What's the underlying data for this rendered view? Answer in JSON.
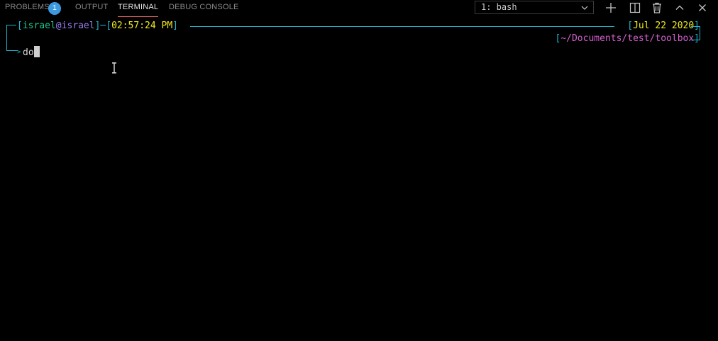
{
  "tabs": [
    {
      "label": "PROBLEMS",
      "active": false
    },
    {
      "label": "OUTPUT",
      "active": false
    },
    {
      "label": "TERMINAL",
      "active": true
    },
    {
      "label": "DEBUG CONSOLE",
      "active": false
    }
  ],
  "problems_count": "1",
  "terminal_select": {
    "value": "1: bash"
  },
  "toolbar_icons": [
    "plus-icon",
    "split-icon",
    "trash-icon",
    "chevron-up-icon",
    "close-icon"
  ],
  "prompt": {
    "user": "israel",
    "at": "@",
    "host": "israel",
    "time": "02:57:24 PM",
    "date": "Jul 22 2020",
    "path": "~/Documents/test/toolbox",
    "command": "do"
  },
  "colors": {
    "bracket": "#1fb4cc",
    "user": "#1ac98f",
    "host": "#9a7df0",
    "time": "#f1ea1c",
    "path": "#d55fd0",
    "badge": "#3c9adf",
    "active_tab_underline": "#e7635f"
  }
}
